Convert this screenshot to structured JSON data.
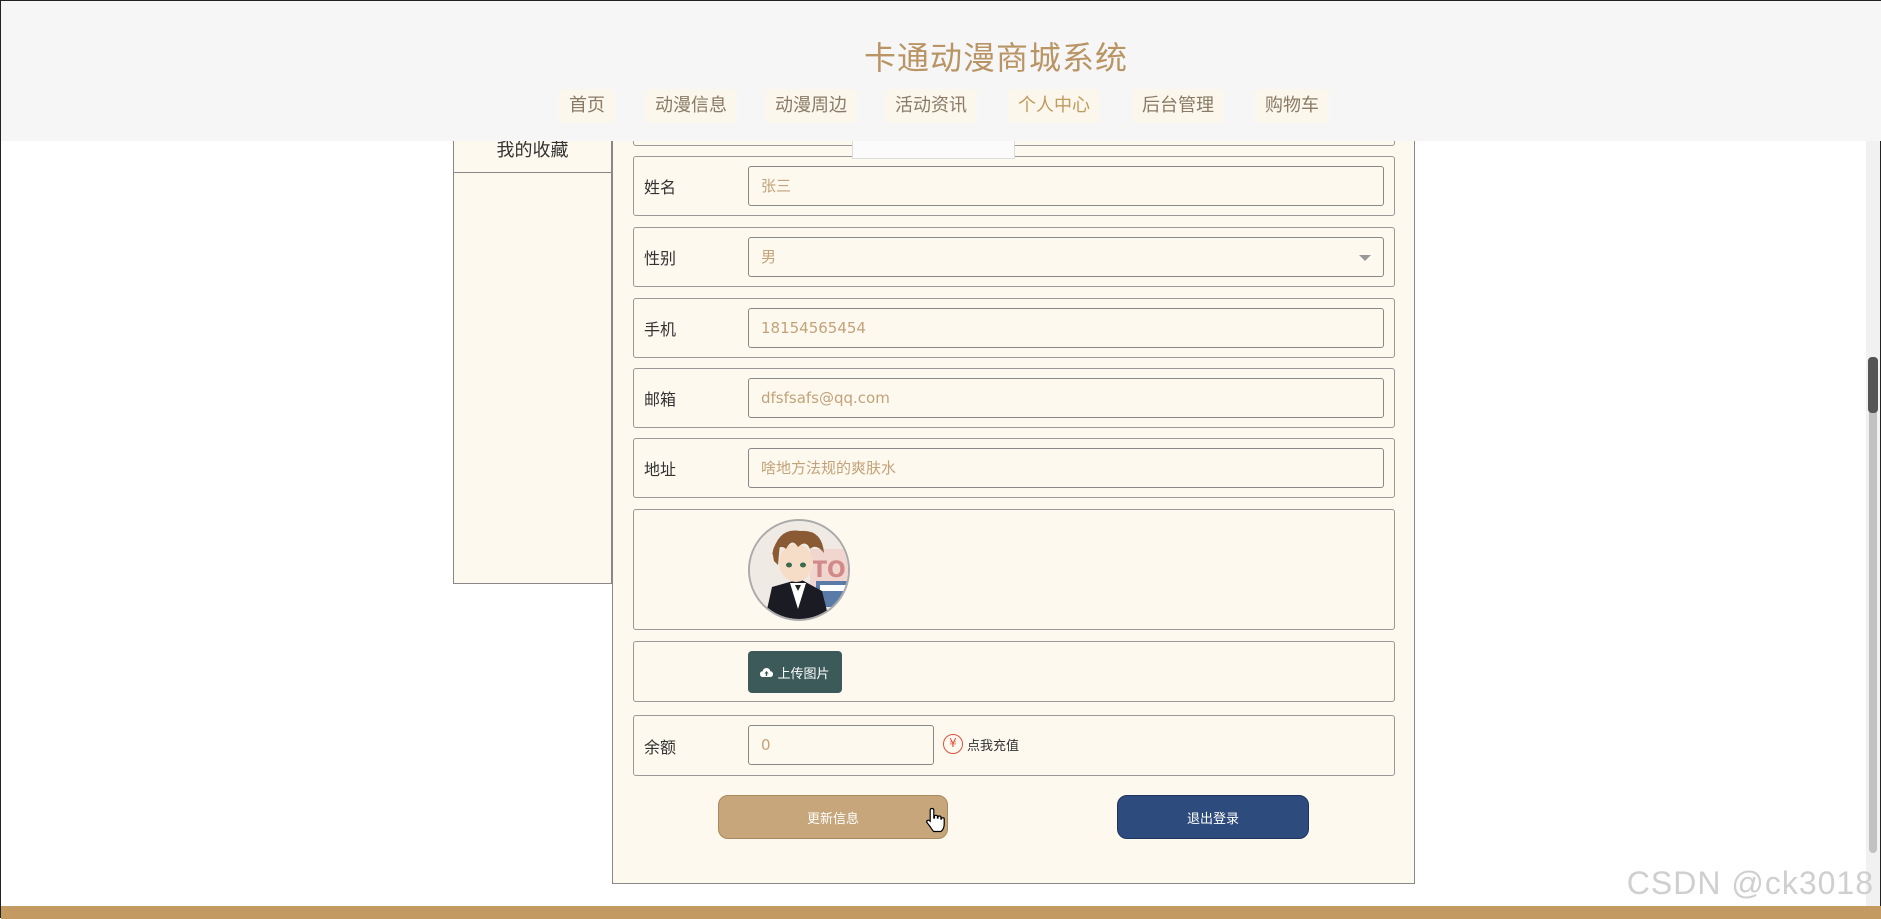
{
  "header": {
    "site_title": "卡通动漫商城系统",
    "nav": [
      {
        "label": "首页"
      },
      {
        "label": "动漫信息"
      },
      {
        "label": "动漫周边"
      },
      {
        "label": "活动资讯"
      },
      {
        "label": "个人中心"
      },
      {
        "label": "后台管理"
      },
      {
        "label": "购物车"
      }
    ]
  },
  "sidebar": {
    "items": [
      {
        "label": "我的收藏"
      }
    ]
  },
  "form": {
    "name_label": "姓名",
    "name_value": "张三",
    "gender_label": "性别",
    "gender_value": "男",
    "phone_label": "手机",
    "phone_value": "18154565454",
    "email_label": "邮箱",
    "email_value": "dfsfsafs@qq.com",
    "address_label": "地址",
    "address_value": "啥地方法规的爽肤水",
    "upload_label": "上传图片",
    "balance_label": "余额",
    "balance_value": "0",
    "recharge_label": "点我充值",
    "yen_symbol": "¥"
  },
  "actions": {
    "update_label": "更新信息",
    "logout_label": "退出登录"
  },
  "watermark": "CSDN @ck3018",
  "colors": {
    "brand": "#b99565",
    "update_button": "#c6a67a",
    "logout_button": "#2d4b7c",
    "upload_button": "#3c5a5a",
    "footer": "#c39a62"
  }
}
